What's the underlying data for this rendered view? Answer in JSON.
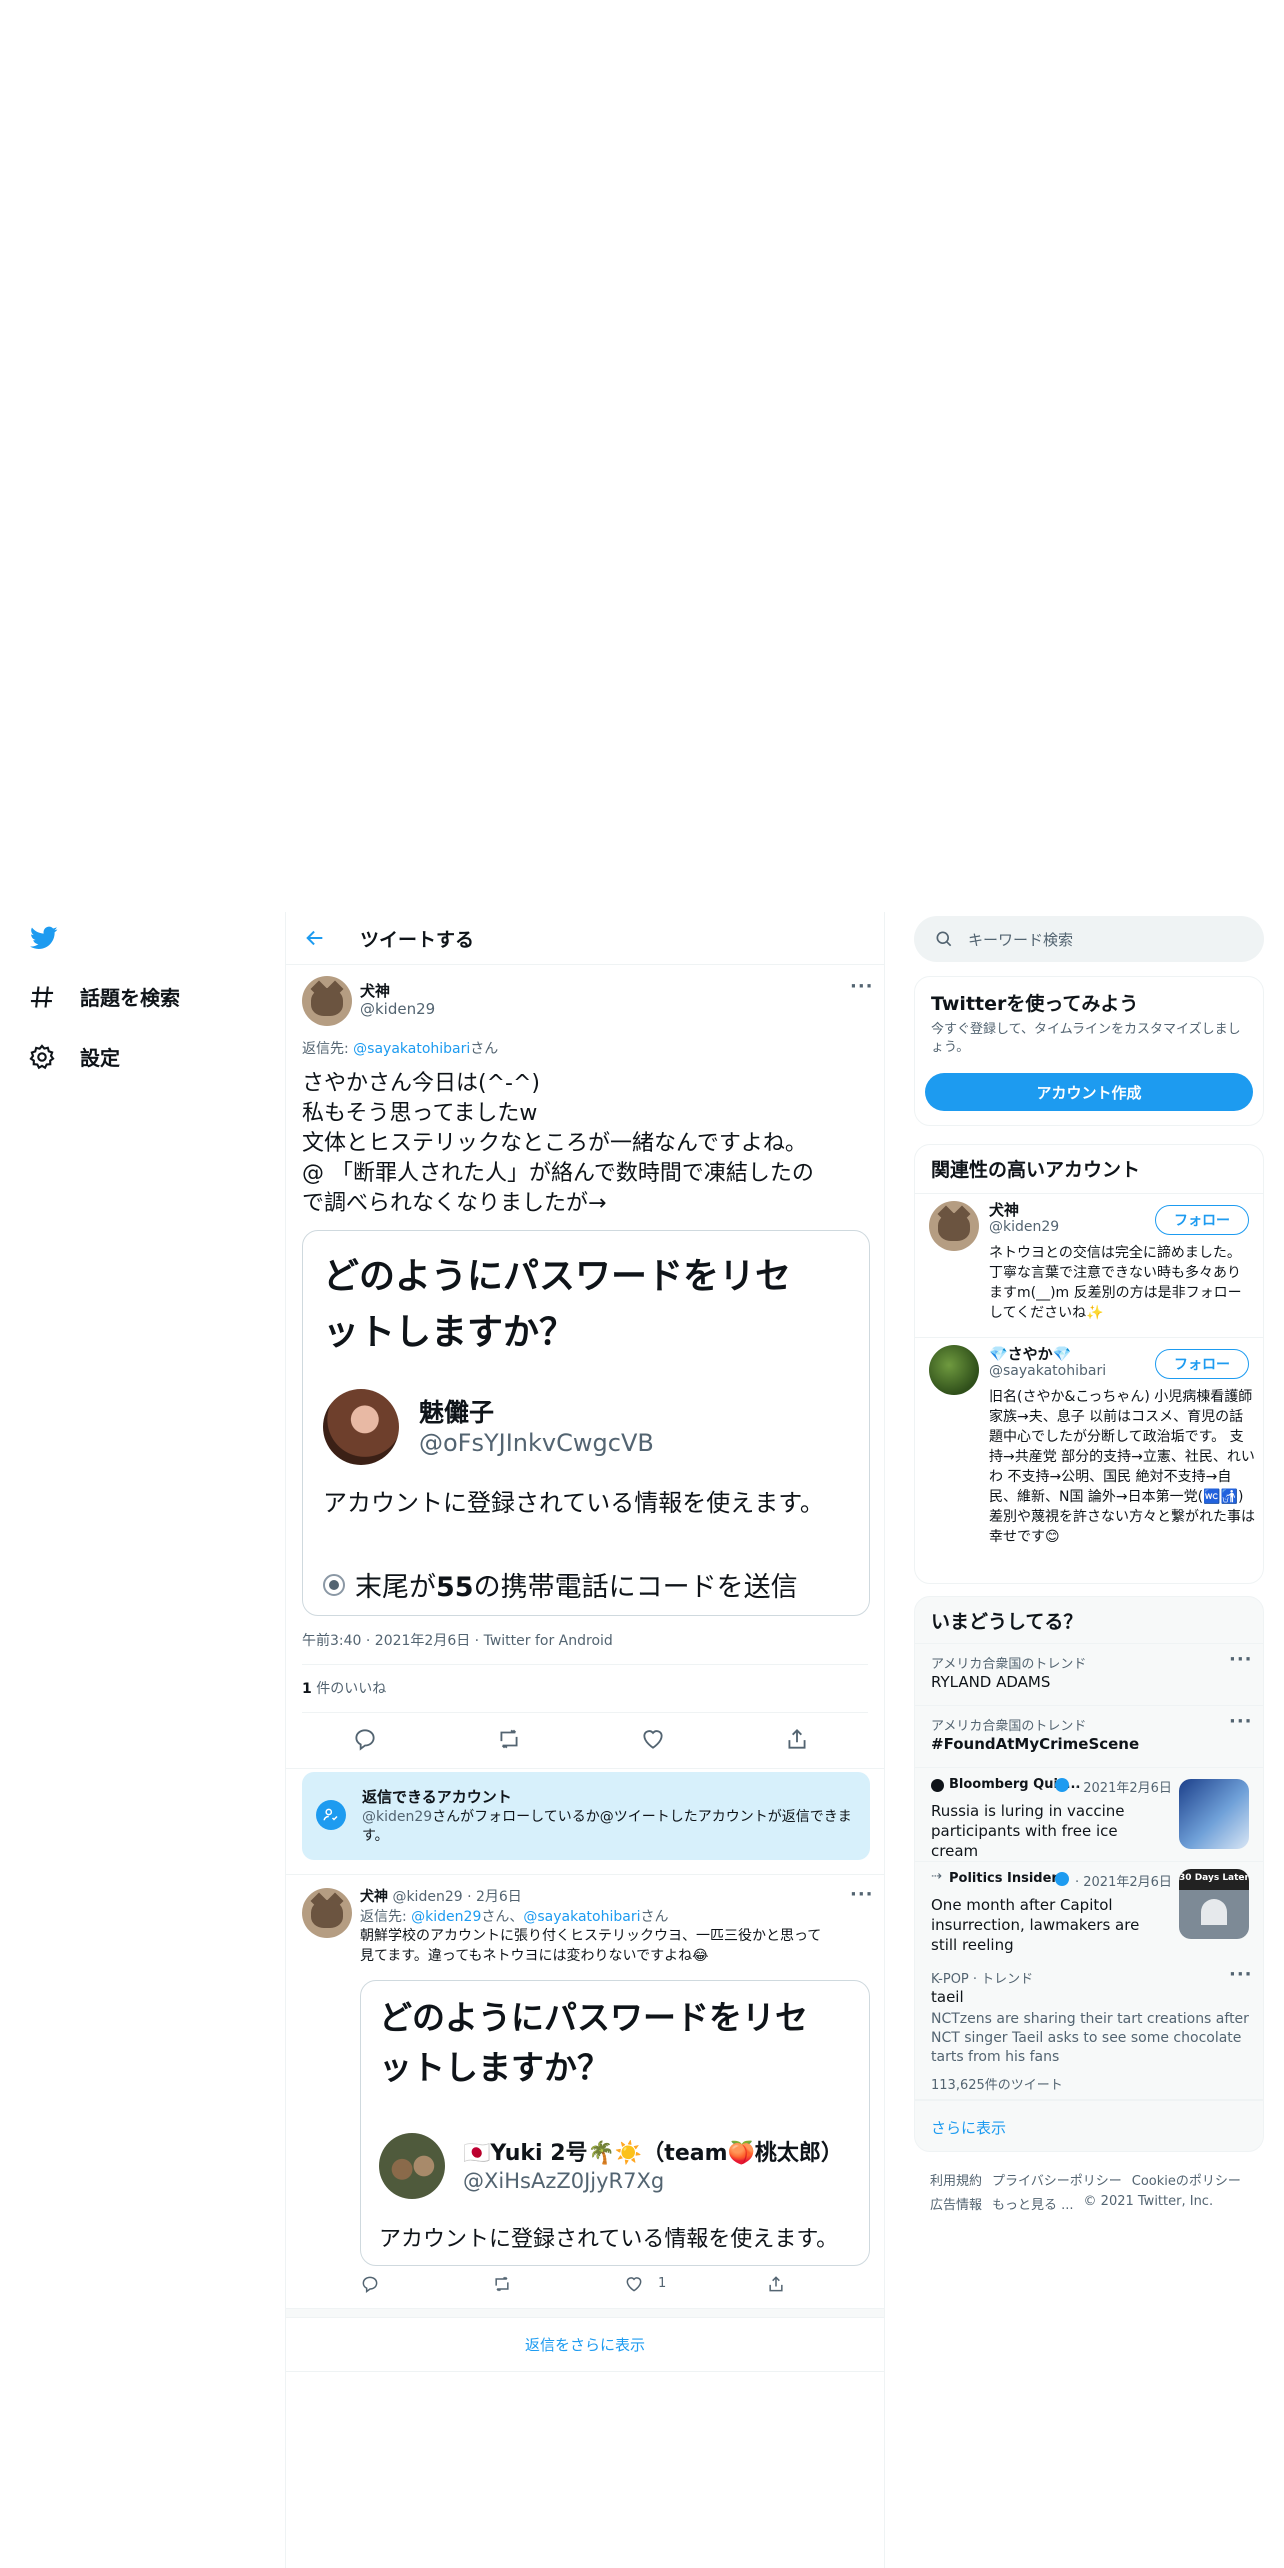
{
  "nav": {
    "explore": "話題を検索",
    "settings": "設定"
  },
  "header": {
    "title": "ツイートする"
  },
  "main_tweet": {
    "name": "犬神",
    "handle": "@kiden29",
    "reply_prefix": "返信先: ",
    "reply_to": "@sayakatohibari",
    "reply_suffix": "さん",
    "lines": [
      "さやかさん今日は(^-^)",
      "私もそう思ってましたw",
      "文体とヒステリックなところが一緒なんですよね。",
      "@ 「断罪人された人」が絡んで数時間で凍結したの",
      "で調べられなくなりましたが→"
    ],
    "card": {
      "title_line1": "どのようにパスワードをリセ",
      "title_line2": "ットしますか？",
      "name": "魅儺子",
      "handle": "@oFsYJInkvCwgcVB",
      "body": "アカウントに登録されている情報を使えます。",
      "option_prefix": "末尾が",
      "option_number": "55",
      "option_suffix": "の携帯電話にコードを送信"
    },
    "meta": "午前3:40 · 2021年2月6日 · Twitter for Android",
    "likes_count": "1",
    "likes_label": " 件のいいね"
  },
  "reply_notice": {
    "title": "返信できるアカウント",
    "handle": "@kiden29",
    "body": "さんがフォローしているか@ツイートしたアカウントが返信できます。"
  },
  "reply_tweet": {
    "name": "犬神",
    "handle_date": "@kiden29 · 2月6日",
    "reply_prefix": "返信先: ",
    "reply_to_1": "@kiden29",
    "reply_mid": "さん、",
    "reply_to_2": "@sayakatohibari",
    "reply_suffix": "さん",
    "line1": "朝鮮学校のアカウントに張り付くヒステリックウヨ、一匹三役かと思って",
    "line2": "見てます。違ってもネトウヨには変わりないですよね😂",
    "card": {
      "title_line1": "どのようにパスワードをリセ",
      "title_line2": "ットしますか？",
      "name": "🇯🇵Yuki 2号🌴☀️（team🍑桃太郎）",
      "handle": "@XiHsAzZ0JjyR7Xg",
      "body": "アカウントに登録されている情報を使えます。"
    },
    "like_count": "1"
  },
  "show_more_replies": "返信をさらに表示",
  "search": {
    "placeholder": "キーワード検索"
  },
  "signup": {
    "title": "Twitterを使ってみよう",
    "subtitle": "今すぐ登録して、タイムラインをカスタマイズしましょう。",
    "button": "アカウント作成"
  },
  "relevant": {
    "title": "関連性の高いアカウント",
    "follow_label": "フォロー",
    "accounts": [
      {
        "name": "犬神",
        "handle": "@kiden29",
        "bio": "ネトウヨとの交信は完全に諦めました。 丁寧な言葉で注意できない時も多々ありますm(__)m 反差別の方は是非フォローしてくださいね✨"
      },
      {
        "name": "💎さやか💎",
        "handle": "@sayakatohibari",
        "bio": "旧名(さやか&こっちゃん) 小児病棟看護師 家族→夫、息子 以前はコスメ、育児の話題中心でしたが分断して政治垢です。 支持→共産党 部分的支持→立憲、社民、れいわ 不支持→公明、国民 絶対不支持→自民、維新、N国 論外→日本第一党(🚾🚮) 差別や蔑視を許さない方々と繋がれた事は幸せです😊"
      }
    ]
  },
  "trends": {
    "title": "いまどうしてる？",
    "items": [
      {
        "meta": "アメリカ合衆国のトレンド",
        "name": "RYLAND ADAMS"
      },
      {
        "meta": "アメリカ合衆国のトレンド",
        "name": "#FoundAtMyCrimeScene"
      },
      {
        "source": "Bloomberg Quic...",
        "date": "· 2021年2月6日",
        "headline": "Russia is luring in vaccine participants with free ice cream"
      },
      {
        "source": "Politics Insider",
        "date": "· 2021年2月6日",
        "headline": "One month after Capitol insurrection, lawmakers are still reeling",
        "thumb_text": "30 Days Later"
      },
      {
        "meta": "K-POP · トレンド",
        "name": "taeil",
        "desc": "NCTzens are sharing their tart creations after NCT singer Taeil asks to see some chocolate tarts from his fans",
        "count": "113,625件のツイート"
      }
    ],
    "show_more": "さらに表示"
  },
  "footer": {
    "line1": [
      "利用規約",
      "プライバシーポリシー",
      "Cookieのポリシー"
    ],
    "line2": [
      "広告情報",
      "もっと見る ...",
      "© 2021 Twitter, Inc."
    ]
  },
  "colors": {
    "accent": "#1d9bf0",
    "muted": "#536471"
  }
}
